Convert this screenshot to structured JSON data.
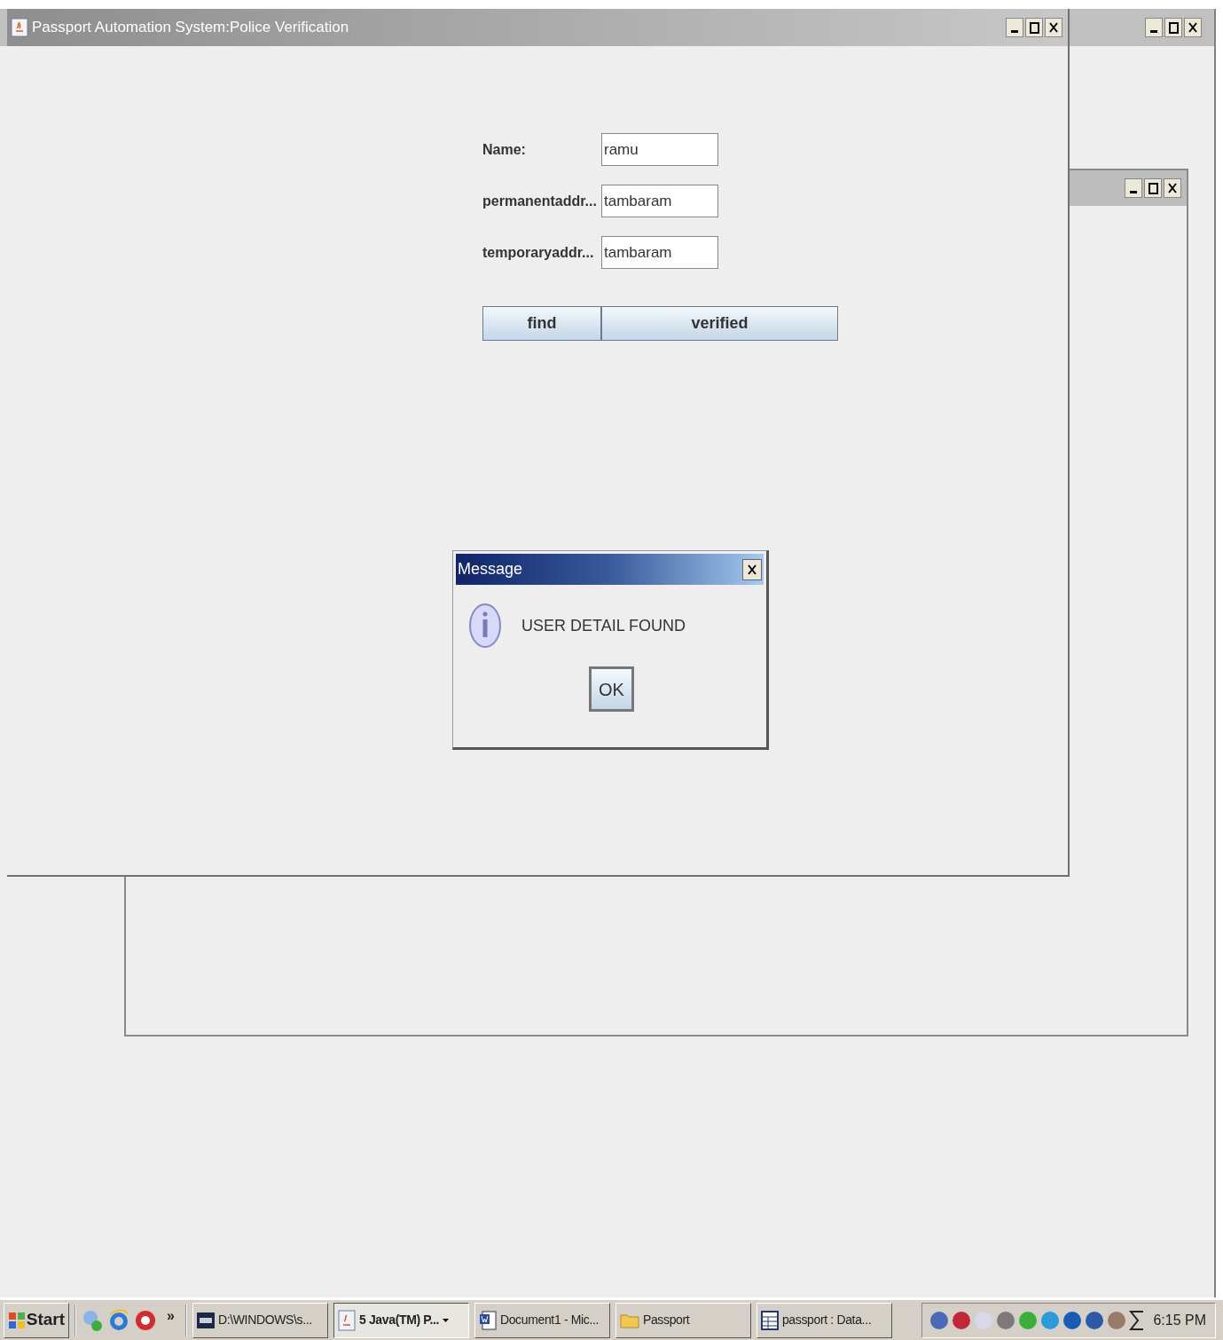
{
  "main_window": {
    "title": "Passport Automation System:Police Verification",
    "fields": [
      {
        "label": "Name:",
        "value": "ramu"
      },
      {
        "label": "permanentaddr...",
        "value": "tambaram"
      },
      {
        "label": "temporaryaddr...",
        "value": "tambaram"
      }
    ],
    "buttons": [
      "find",
      "verified"
    ]
  },
  "dialog": {
    "title": "Message",
    "message": "USER DETAIL FOUND",
    "button": "OK"
  },
  "taskbar": {
    "start": "Start",
    "more": "»",
    "tasks": [
      {
        "label": "D:\\WINDOWS\\s...",
        "kind": "console",
        "selected": false
      },
      {
        "label": "5 Java(TM) P...",
        "kind": "java",
        "selected": true
      },
      {
        "label": "Document1 - Mic...",
        "kind": "word",
        "selected": false
      },
      {
        "label": "Passport",
        "kind": "folder",
        "selected": false
      },
      {
        "label": "passport : Data...",
        "kind": "database",
        "selected": false
      }
    ],
    "clock": "6:15 PM"
  }
}
